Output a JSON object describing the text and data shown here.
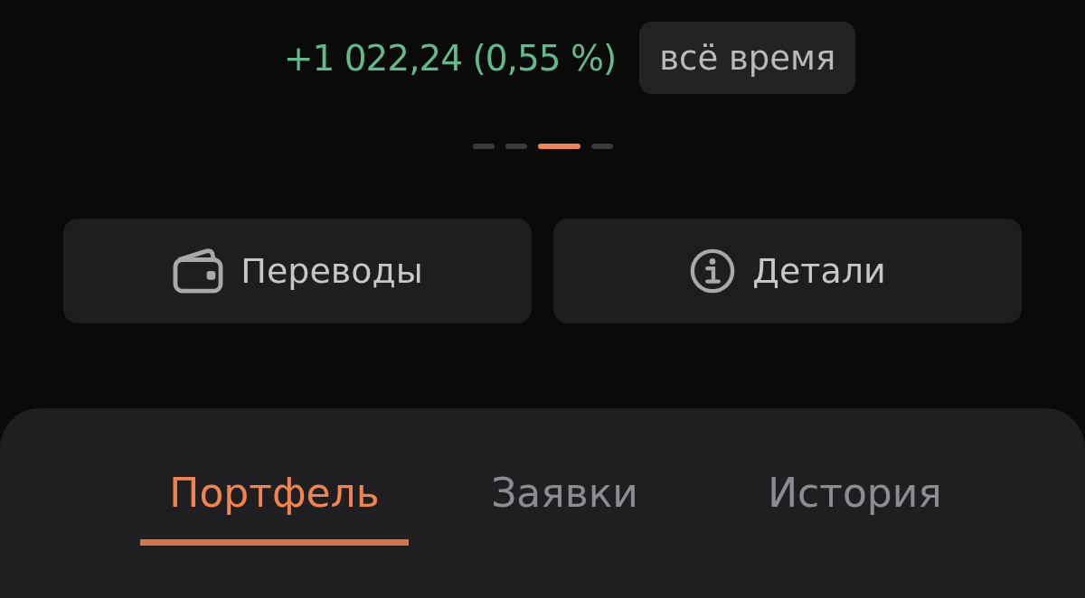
{
  "summary": {
    "change": "+1 022,24 (0,55 %)",
    "period": "всё время"
  },
  "pager": [
    {
      "selected": false
    },
    {
      "selected": false
    },
    {
      "selected": true
    },
    {
      "selected": false
    }
  ],
  "actions": [
    {
      "kind": "wallet",
      "label": "Переводы"
    },
    {
      "kind": "info",
      "label": "Детали"
    }
  ],
  "tabs": [
    {
      "label": "Портфель",
      "selected": true
    },
    {
      "label": "Заявки",
      "selected": false
    },
    {
      "label": "История",
      "selected": false
    }
  ]
}
